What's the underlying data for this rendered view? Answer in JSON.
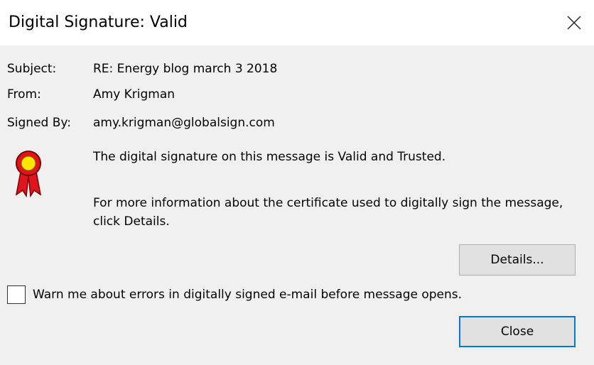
{
  "window": {
    "title": "Digital Signature: Valid",
    "close_icon": "close-icon"
  },
  "fields": {
    "subject_label": "Subject:",
    "subject_value": "RE: Energy blog march 3 2018",
    "from_label": "From:",
    "from_value": "Amy Krigman",
    "signed_by_label": "Signed By:",
    "signed_by_value": "amy.krigman@globalsign.com"
  },
  "status": {
    "icon": "certificate-seal-icon",
    "valid_message": "The digital signature on this message is Valid and Trusted.",
    "info_message": "For more information about the certificate used to digitally sign the message, click Details."
  },
  "buttons": {
    "details_label": "Details...",
    "close_label": "Close"
  },
  "warn_option": {
    "label": "Warn me about errors in digitally signed e-mail before message opens.",
    "checked": false
  },
  "colors": {
    "dialog_background": "#f0f0f0",
    "titlebar_background": "#ffffff",
    "button_background": "#e1e1e1",
    "focus_border": "#0078d7",
    "seal_ribbon": "#e0141c",
    "seal_center": "#ffe600"
  }
}
